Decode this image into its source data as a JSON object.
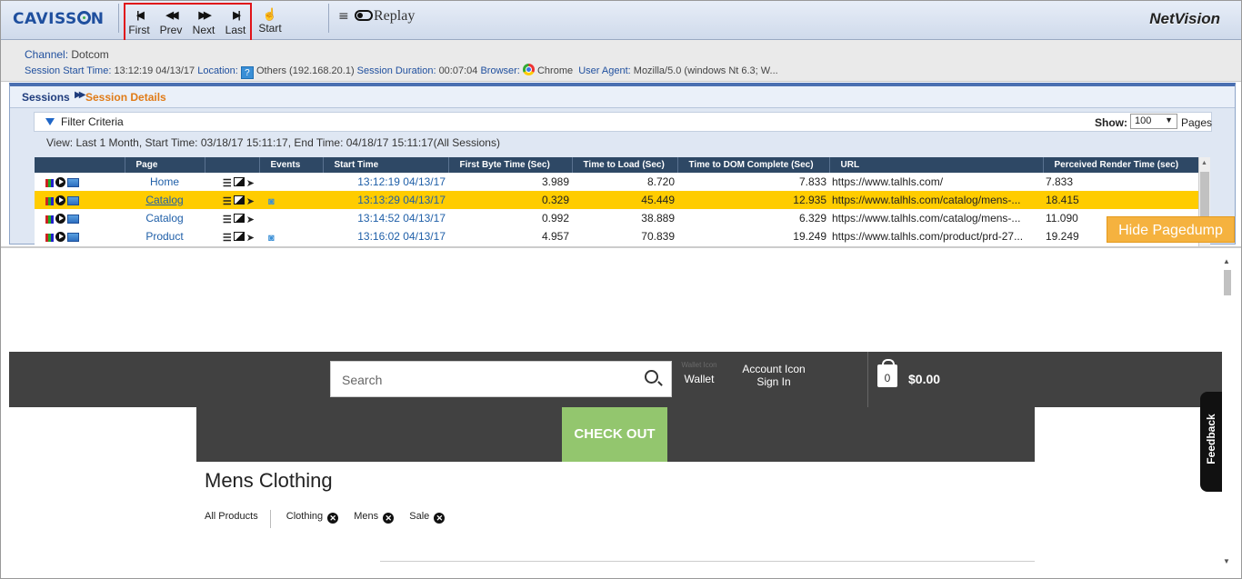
{
  "header": {
    "logo": "CAVISS",
    "logo_tail": "N",
    "nav": {
      "first": "First",
      "prev": "Prev",
      "next": "Next",
      "last": "Last",
      "start": "Start"
    },
    "replay_label": "Replay",
    "product": "NetVision"
  },
  "session_info": {
    "channel_label": "Channel:",
    "channel_value": "Dotcom",
    "start_label": "Session Start Time:",
    "start_value": "13:12:19 04/13/17",
    "location_label": "Location:",
    "location_value": "Others (192.168.20.1)",
    "duration_label": "Session Duration:",
    "duration_value": "00:07:04",
    "browser_label": "Browser:",
    "browser_value": "Chrome",
    "ua_label": "User Agent:",
    "ua_value": "Mozilla/5.0 (windows Nt 6.3; W..."
  },
  "breadcrumb": {
    "sessions": "Sessions",
    "details": "Session Details"
  },
  "filter": {
    "title": "Filter Criteria",
    "show_label": "Show:",
    "show_value": "100",
    "pages_label": "Pages",
    "view_text": "View: Last 1 Month, Start Time: 03/18/17 15:11:17, End Time: 04/18/17 15:11:17(All Sessions)"
  },
  "table": {
    "headers": [
      "",
      "Page",
      "",
      "Events",
      "Start Time",
      "First Byte Time (Sec)",
      "Time to Load (Sec)",
      "Time to DOM Complete (Sec)",
      "URL",
      "Perceived Render Time (sec)"
    ],
    "rows": [
      {
        "page": "Home",
        "start": "13:12:19 04/13/17",
        "fbt": "3.989",
        "load": "8.720",
        "dom": "7.833",
        "url": "https://www.talhls.com/",
        "prt": "7.833",
        "has_event": false
      },
      {
        "page": "Catalog",
        "start": "13:13:29 04/13/17",
        "fbt": "0.329",
        "load": "45.449",
        "dom": "12.935",
        "url": "https://www.talhls.com/catalog/mens-...",
        "prt": "18.415",
        "has_event": true
      },
      {
        "page": "Catalog",
        "start": "13:14:52 04/13/17",
        "fbt": "0.992",
        "load": "38.889",
        "dom": "6.329",
        "url": "https://www.talhls.com/catalog/mens-...",
        "prt": "11.090",
        "has_event": false
      },
      {
        "page": "Product",
        "start": "13:16:02 04/13/17",
        "fbt": "4.957",
        "load": "70.839",
        "dom": "19.249",
        "url": "https://www.talhls.com/product/prd-27...",
        "prt": "19.249",
        "has_event": true
      }
    ],
    "selected_row": 1
  },
  "hide_pagedump": "Hide Pagedump",
  "pagedump": {
    "search_placeholder": "Search",
    "wallet_alt": "Wallet Icon",
    "wallet_label": "Wallet",
    "account_alt": "Account Icon",
    "sign_in": "Sign In",
    "cart_count": "0",
    "cart_total": "$0.00",
    "checkout": "CHECK OUT",
    "heading": "Mens Clothing",
    "facet_all": "All Products",
    "facets": [
      "Clothing",
      "Mens",
      "Sale"
    ],
    "feedback": "Feedback"
  }
}
